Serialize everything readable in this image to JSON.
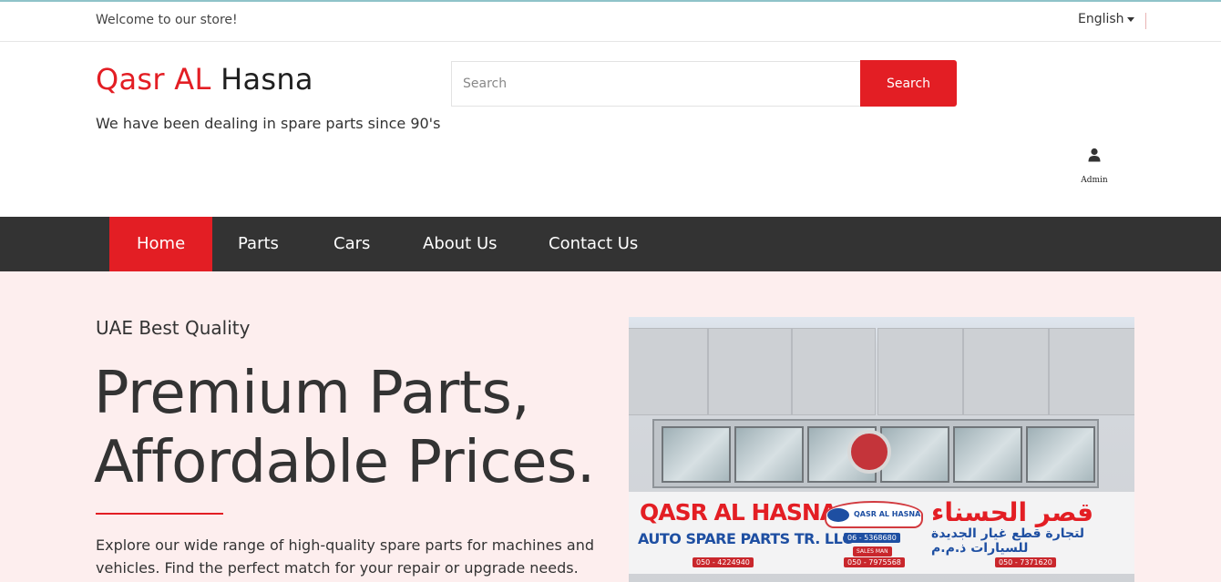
{
  "topbar": {
    "welcome": "Welcome to our store!",
    "language": "English"
  },
  "header": {
    "brand_part1": "Qasr AL",
    "brand_part2": "Hasna",
    "tagline": "We have been dealing in spare parts since 90's",
    "search_placeholder": "Search",
    "search_button": "Search",
    "account_label": "Admin",
    "account_icon": "user-icon"
  },
  "nav": {
    "items": [
      {
        "label": "Home",
        "active": true
      },
      {
        "label": "Parts",
        "active": false
      },
      {
        "label": "Cars",
        "active": false
      },
      {
        "label": "About Us",
        "active": false
      },
      {
        "label": "Contact Us",
        "active": false
      }
    ]
  },
  "hero": {
    "eyebrow": "UAE Best Quality",
    "headline_line1": "Premium Parts,",
    "headline_line2": "Affordable Prices.",
    "description": "Explore our wide range of high-quality spare parts for machines and vehicles. Find the perfect match for your repair or upgrade needs.",
    "image_sign": {
      "title": "QASR AL HASNA",
      "subtitle": "AUTO SPARE PARTS TR. LLC",
      "arabic_title": "قصر الحسناء",
      "arabic_subtitle": "لتجارة قطع غيار الجديدة للسيارات ذ.م.م",
      "logo_text": "QASR AL HASNA",
      "phone_1": "050 - 4224940",
      "phone_2": "06 - 5368680",
      "phone_3": "050 - 7975568",
      "phone_4": "050 - 7371620",
      "sales_label": "SALES MAN"
    }
  },
  "colors": {
    "accent": "#e31e24",
    "nav_bg": "#333333",
    "hero_bg": "#fdeeee",
    "sign_blue": "#1e4fa2"
  }
}
